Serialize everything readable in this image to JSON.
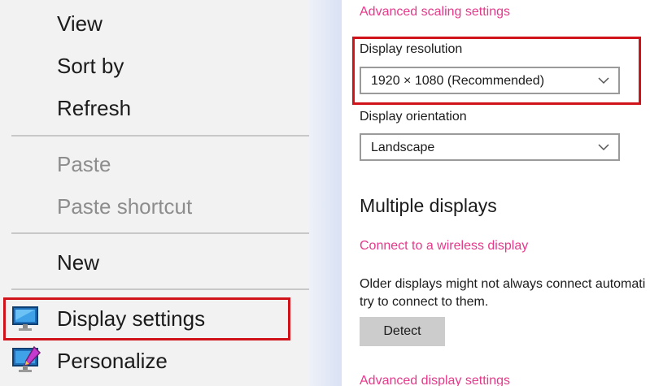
{
  "context_menu": {
    "items": [
      {
        "label": "View"
      },
      {
        "label": "Sort by"
      },
      {
        "label": "Refresh"
      },
      {
        "label": "Paste"
      },
      {
        "label": "Paste shortcut"
      },
      {
        "label": "New"
      },
      {
        "label": "Display settings",
        "icon": "monitor-icon"
      },
      {
        "label": "Personalize",
        "icon": "personalize-icon"
      }
    ]
  },
  "settings": {
    "advanced_scaling_link": "Advanced scaling settings",
    "resolution_label": "Display resolution",
    "resolution_value": "1920 × 1080 (Recommended)",
    "orientation_label": "Display orientation",
    "orientation_value": "Landscape",
    "multiple_displays_heading": "Multiple displays",
    "wireless_link": "Connect to a wireless display",
    "older_displays_line1": "Older displays might not always connect automati",
    "older_displays_line2": "try to connect to them.",
    "detect_button": "Detect",
    "advanced_display_link": "Advanced display settings"
  },
  "colors": {
    "highlight": "#d0121b",
    "link": "#e5398a",
    "menu_bg": "#f2f2f2"
  }
}
